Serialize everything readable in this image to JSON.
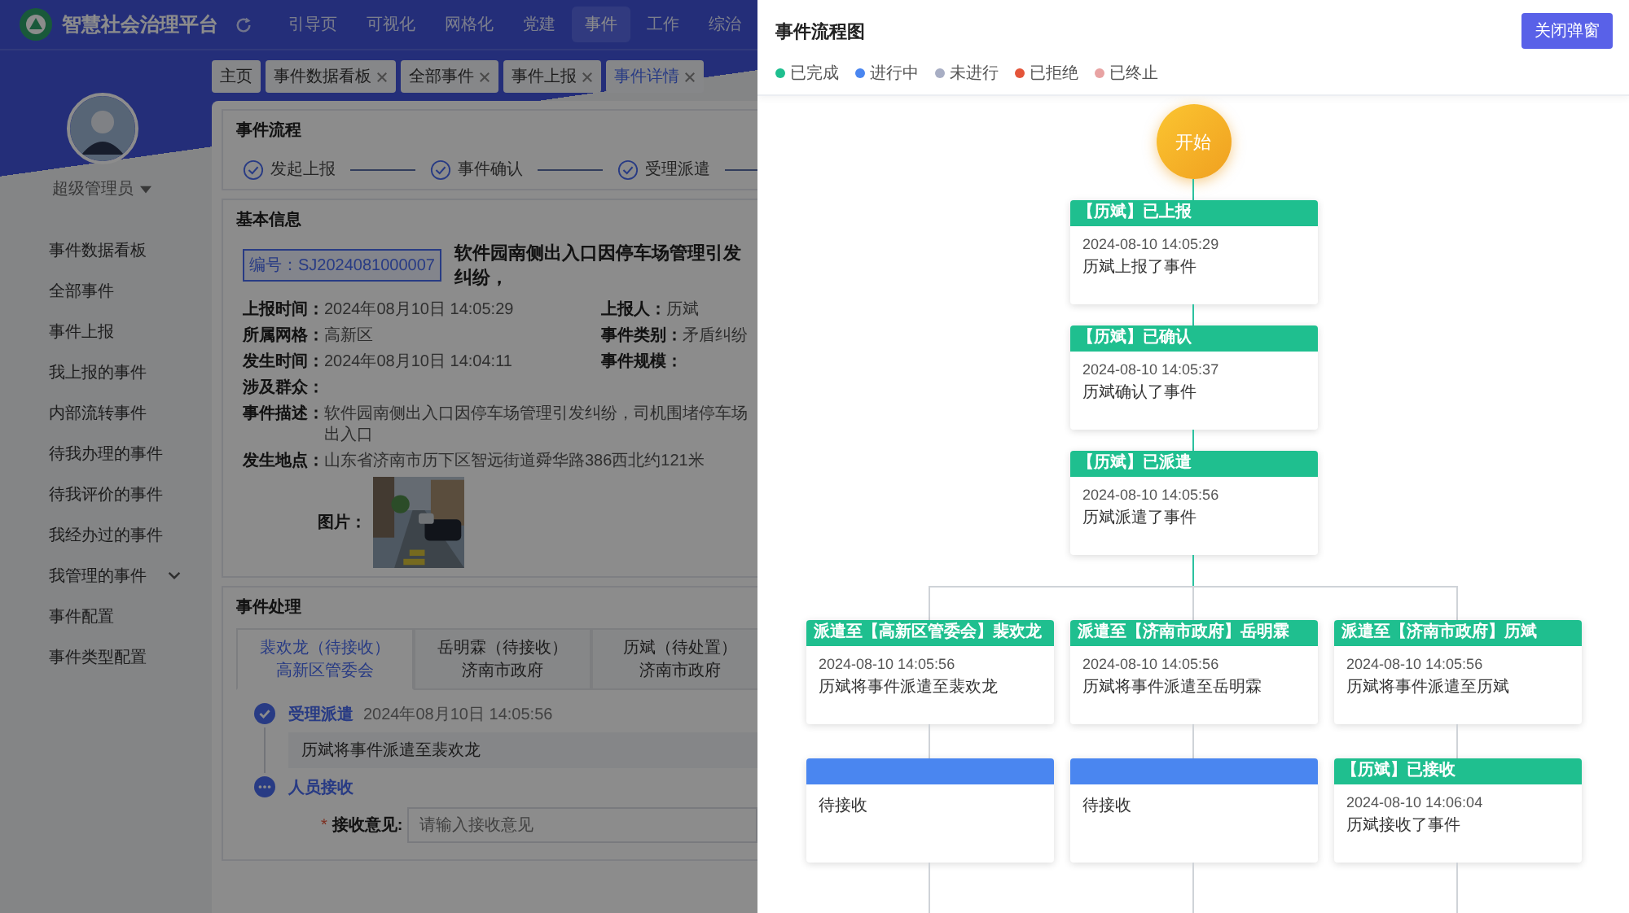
{
  "header": {
    "title": "智慧社会治理平台",
    "nav": [
      {
        "label": "引导页",
        "selected": false
      },
      {
        "label": "可视化",
        "selected": false
      },
      {
        "label": "网格化",
        "selected": false
      },
      {
        "label": "党建",
        "selected": false
      },
      {
        "label": "事件",
        "selected": true
      },
      {
        "label": "工作",
        "selected": false
      },
      {
        "label": "综治",
        "selected": false
      }
    ]
  },
  "tabs": [
    {
      "label": "主页",
      "closable": false,
      "selected": false
    },
    {
      "label": "事件数据看板",
      "closable": true,
      "selected": false
    },
    {
      "label": "全部事件",
      "closable": true,
      "selected": false
    },
    {
      "label": "事件上报",
      "closable": true,
      "selected": false
    },
    {
      "label": "事件详情",
      "closable": true,
      "selected": true
    }
  ],
  "user": {
    "name": "超级管理员"
  },
  "sidebar": [
    {
      "label": "事件数据看板",
      "has_submenu": false
    },
    {
      "label": "全部事件",
      "has_submenu": false
    },
    {
      "label": "事件上报",
      "has_submenu": false
    },
    {
      "label": "我上报的事件",
      "has_submenu": false
    },
    {
      "label": "内部流转事件",
      "has_submenu": false
    },
    {
      "label": "待我办理的事件",
      "has_submenu": false
    },
    {
      "label": "待我评价的事件",
      "has_submenu": false
    },
    {
      "label": "我经办过的事件",
      "has_submenu": false
    },
    {
      "label": "我管理的事件",
      "has_submenu": true
    },
    {
      "label": "事件配置",
      "has_submenu": false
    },
    {
      "label": "事件类型配置",
      "has_submenu": false
    }
  ],
  "process": {
    "title": "事件流程",
    "steps": [
      {
        "label": "发起上报",
        "done": true
      },
      {
        "label": "事件确认",
        "done": true
      },
      {
        "label": "受理派遣",
        "done": true
      }
    ]
  },
  "basic_info": {
    "title": "基本信息",
    "code": "编号：SJ2024081000007",
    "headline": "软件园南侧出入口因停车场管理引发纠纷，",
    "rows": [
      [
        {
          "label": "上报时间：",
          "value": "2024年08月10日 14:05:29"
        },
        {
          "label": "上报人：",
          "value": "历斌"
        }
      ],
      [
        {
          "label": "所属网格：",
          "value": "高新区"
        },
        {
          "label": "事件类别：",
          "value": "矛盾纠纷"
        }
      ],
      [
        {
          "label": "发生时间：",
          "value": "2024年08月10日 14:04:11"
        },
        {
          "label": "事件规模："
        }
      ],
      [
        {
          "label": "涉及群众："
        }
      ],
      [
        {
          "label": "事件描述：",
          "value": "软件园南侧出入口因停车场管理引发纠纷，司机围堵停车场出入口"
        }
      ],
      [
        {
          "label": "发生地点：",
          "value": "山东省济南市历下区智远街道舜华路386西北约121米"
        }
      ]
    ],
    "picture_label": "图片："
  },
  "handling": {
    "title": "事件处理",
    "tabs": [
      {
        "name": "裴欢龙（待接收）",
        "org": "高新区管委会",
        "selected": true
      },
      {
        "name": "岳明霖（待接收）",
        "org": "济南市政府",
        "selected": false
      },
      {
        "name": "历斌（待处置）",
        "org": "济南市政府",
        "selected": false
      }
    ],
    "timeline": [
      {
        "kind": "done",
        "title": "受理派遣",
        "time": "2024年08月10日 14:05:56",
        "note": "历斌将事件派遣至裴欢龙"
      },
      {
        "kind": "current",
        "title": "人员接收",
        "field": {
          "required_mark": "*",
          "label": "接收意见:",
          "placeholder": "请输入接收意见"
        }
      }
    ]
  },
  "drawer": {
    "title": "事件流程图",
    "close_button": "关闭弹窗",
    "legend": [
      {
        "label": "已完成",
        "color": "#1fbf8f"
      },
      {
        "label": "进行中",
        "color": "#4a86f0"
      },
      {
        "label": "未进行",
        "color": "#a8aec4"
      },
      {
        "label": "已拒绝",
        "color": "#e4553a"
      },
      {
        "label": "已终止",
        "color": "#e8a3a3"
      }
    ],
    "start": "开始",
    "trunk": [
      {
        "kind": "done",
        "title": "【历斌】已上报",
        "time": "2024-08-10 14:05:29",
        "note": "历斌上报了事件"
      },
      {
        "kind": "done",
        "title": "【历斌】已确认",
        "time": "2024-08-10 14:05:37",
        "note": "历斌确认了事件"
      },
      {
        "kind": "done",
        "title": "【历斌】已派遣",
        "time": "2024-08-10 14:05:56",
        "note": "历斌派遣了事件"
      }
    ],
    "branches": [
      [
        {
          "kind": "done",
          "title": "派遣至【高新区管委会】裴欢龙",
          "time": "2024-08-10 14:05:56",
          "note": "历斌将事件派遣至裴欢龙"
        },
        {
          "kind": "progress",
          "note": "待接收"
        }
      ],
      [
        {
          "kind": "done",
          "title": "派遣至【济南市政府】岳明霖",
          "time": "2024-08-10 14:05:56",
          "note": "历斌将事件派遣至岳明霖"
        },
        {
          "kind": "progress",
          "note": "待接收"
        }
      ],
      [
        {
          "kind": "done",
          "title": "派遣至【济南市政府】历斌",
          "time": "2024-08-10 14:05:56",
          "note": "历斌将事件派遣至历斌"
        },
        {
          "kind": "done",
          "title": "【历斌】已接收",
          "time": "2024-08-10 14:06:04",
          "note": "历斌接收了事件"
        }
      ]
    ]
  }
}
